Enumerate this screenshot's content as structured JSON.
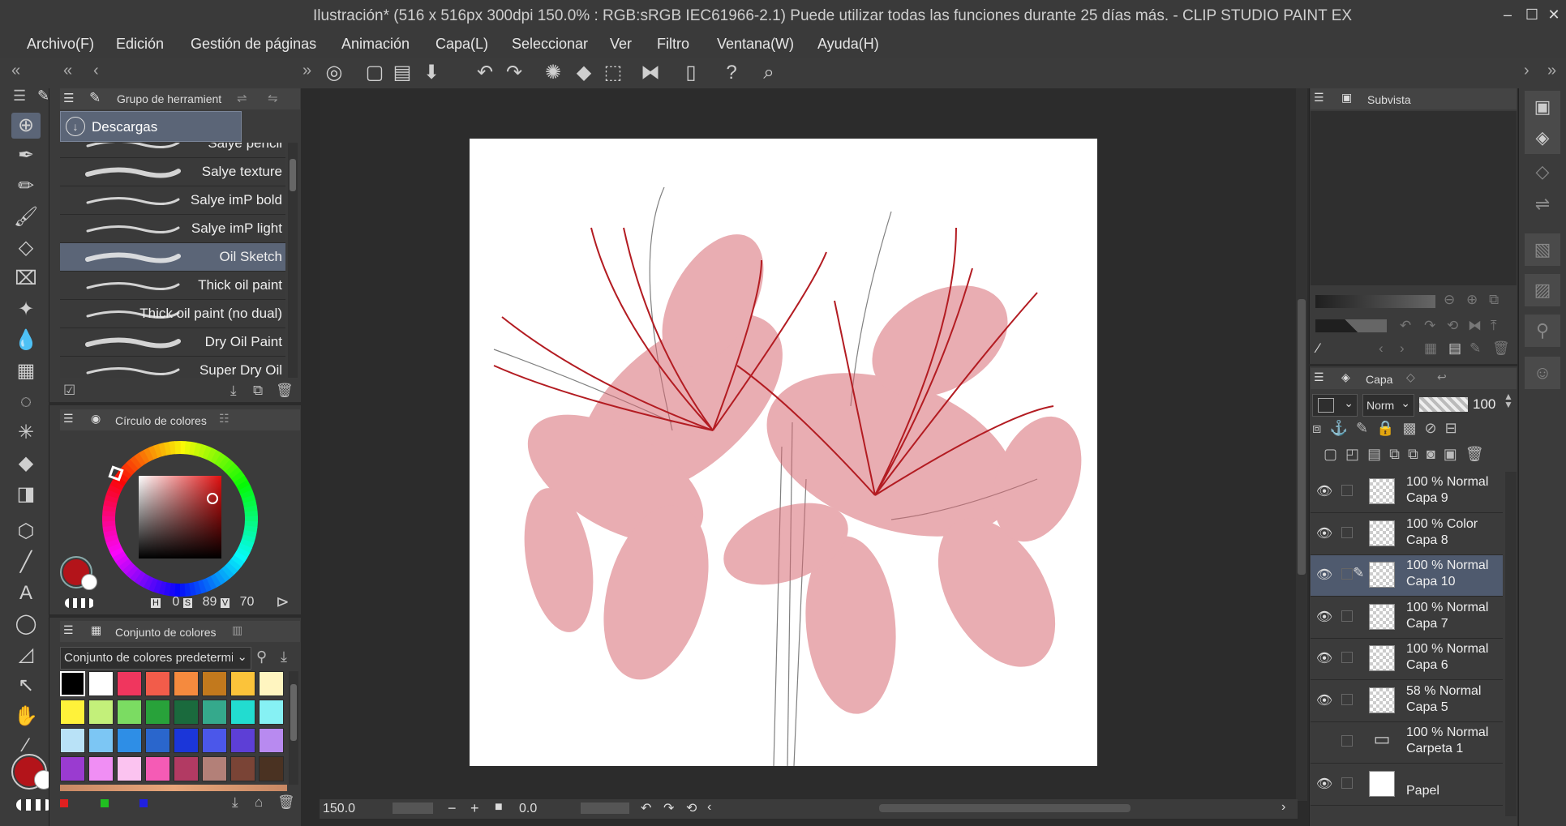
{
  "window": {
    "title": "Ilustración* (516 x 516px 300dpi 150.0% : RGB:sRGB IEC61966-2.1)  Puede utilizar todas las funciones durante 25 días más. - CLIP STUDIO PAINT EX"
  },
  "menu": [
    "Archivo(F)",
    "Edición",
    "Gestión de páginas",
    "Animación",
    "Capa(L)",
    "Seleccionar",
    "Ver",
    "Filtro",
    "Ventana(W)",
    "Ayuda(H)"
  ],
  "tool_group": {
    "header": "Grupo de herramient",
    "current_group": "Descargas",
    "brushes": [
      {
        "label": "Salye pencil",
        "selected": false
      },
      {
        "label": "Salye texture",
        "selected": false
      },
      {
        "label": "Salye imP bold",
        "selected": false
      },
      {
        "label": "Salye imP light",
        "selected": false
      },
      {
        "label": "Oil Sketch",
        "selected": true
      },
      {
        "label": "Thick oil paint",
        "selected": false
      },
      {
        "label": "Thick oil paint (no dual)",
        "selected": false
      },
      {
        "label": "Dry Oil Paint",
        "selected": false
      },
      {
        "label": "Super Dry Oil",
        "selected": false
      }
    ]
  },
  "color_wheel": {
    "header": "Círculo de colores",
    "h_label": "H",
    "h": "0",
    "s_label": "S",
    "s": "89",
    "v_label": "V",
    "v": "70",
    "main_color": "#b3141a"
  },
  "color_set": {
    "header": "Conjunto de colores",
    "selected_set": "Conjunto de colores predeterminad",
    "swatches": [
      "#000000",
      "#ffffff",
      "#f0365e",
      "#f25c4a",
      "#f58a3e",
      "#c2791d",
      "#fbc33a",
      "#fff5c0",
      "#fff23a",
      "#c3f07a",
      "#7bdc62",
      "#28a23a",
      "#1a6a3d",
      "#35a98c",
      "#22dcd0",
      "#86f1f4",
      "#b9e2f7",
      "#7cc6f4",
      "#2e8ee6",
      "#2a66cc",
      "#1b36d9",
      "#4b57ea",
      "#5d3fd6",
      "#b88af0",
      "#9a3bd0",
      "#f08ef4",
      "#fbc3f0",
      "#f55bb5",
      "#b23a63",
      "#b38078",
      "#7a4436",
      "#4a3222"
    ]
  },
  "subview": {
    "header": "Subvista"
  },
  "layers": {
    "header": "Capa",
    "blend_mode": "Norm",
    "opacity": "100",
    "items": [
      {
        "line1": "100 % Normal",
        "line2": "Capa 9",
        "selected": false,
        "visible": true
      },
      {
        "line1": "100 % Color",
        "line2": "Capa 8",
        "selected": false,
        "visible": true
      },
      {
        "line1": "100 % Normal",
        "line2": "Capa 10",
        "selected": true,
        "visible": true
      },
      {
        "line1": "100 % Normal",
        "line2": "Capa 7",
        "selected": false,
        "visible": true
      },
      {
        "line1": "100 % Normal",
        "line2": "Capa 6",
        "selected": false,
        "visible": true
      },
      {
        "line1": "58 % Normal",
        "line2": "Capa 5",
        "selected": false,
        "visible": true
      },
      {
        "line1": "100 % Normal",
        "line2": "Carpeta 1",
        "selected": false,
        "visible": false
      },
      {
        "line1": "",
        "line2": "Papel",
        "selected": false,
        "visible": true
      }
    ]
  },
  "status": {
    "zoom": "150.0",
    "angle": "0.0"
  }
}
